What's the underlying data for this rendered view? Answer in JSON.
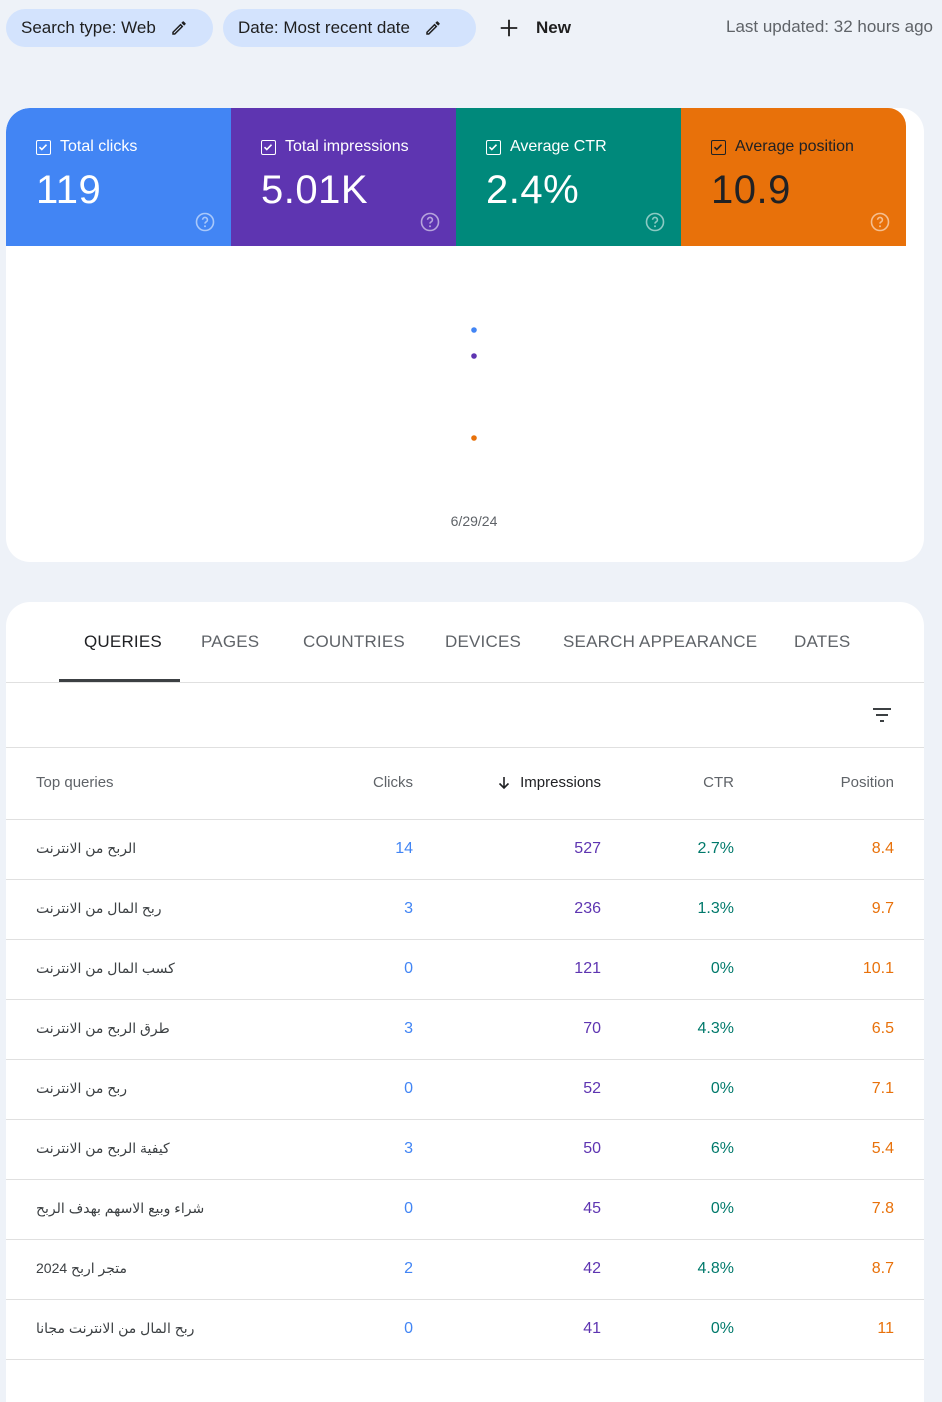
{
  "topbar": {
    "chips": [
      {
        "label": "Search type: Web",
        "icon": "pencil-icon"
      },
      {
        "label": "Date: Most recent date",
        "icon": "pencil-icon"
      }
    ],
    "new_label": "New",
    "last_updated": "Last updated: 32 hours ago"
  },
  "metrics": [
    {
      "label": "Total clicks",
      "value": "119",
      "checked": true,
      "color": "#4285f4"
    },
    {
      "label": "Total impressions",
      "value": "5.01K",
      "checked": true,
      "color": "#5e35b1"
    },
    {
      "label": "Average CTR",
      "value": "2.4%",
      "checked": true,
      "color": "#00897b"
    },
    {
      "label": "Average position",
      "value": "10.9",
      "checked": true,
      "color": "#e8710a"
    }
  ],
  "chart_data": {
    "type": "scatter",
    "title": "",
    "xlabel": "",
    "ylabel": "",
    "x": [
      "6/29/24"
    ],
    "grid": false,
    "series": [
      {
        "name": "Total clicks",
        "values": [
          119
        ],
        "color": "#4285f4"
      },
      {
        "name": "Total impressions",
        "values": [
          5010
        ],
        "color": "#5e35b1"
      },
      {
        "name": "Average CTR",
        "values": [
          2.4
        ],
        "color": "#00897b"
      },
      {
        "name": "Average position",
        "values": [
          10.9
        ],
        "color": "#e8710a"
      }
    ]
  },
  "tabs": [
    {
      "label": "QUERIES",
      "active": true
    },
    {
      "label": "PAGES",
      "active": false
    },
    {
      "label": "COUNTRIES",
      "active": false
    },
    {
      "label": "DEVICES",
      "active": false
    },
    {
      "label": "SEARCH APPEARANCE",
      "active": false
    },
    {
      "label": "DATES",
      "active": false
    }
  ],
  "table": {
    "headers": {
      "query": "Top queries",
      "clicks": "Clicks",
      "impressions": "Impressions",
      "ctr": "CTR",
      "position": "Position"
    },
    "sorted_by": "impressions",
    "rows": [
      {
        "query": "الربح من الانترنت",
        "clicks": "14",
        "impressions": "527",
        "ctr": "2.7%",
        "position": "8.4"
      },
      {
        "query": "ربح المال من الانترنت",
        "clicks": "3",
        "impressions": "236",
        "ctr": "1.3%",
        "position": "9.7"
      },
      {
        "query": "كسب المال من الانترنت",
        "clicks": "0",
        "impressions": "121",
        "ctr": "0%",
        "position": "10.1"
      },
      {
        "query": "طرق الربح من الانترنت",
        "clicks": "3",
        "impressions": "70",
        "ctr": "4.3%",
        "position": "6.5"
      },
      {
        "query": "ربح من الانترنت",
        "clicks": "0",
        "impressions": "52",
        "ctr": "0%",
        "position": "7.1"
      },
      {
        "query": "كيفية الربح من الانترنت",
        "clicks": "3",
        "impressions": "50",
        "ctr": "6%",
        "position": "5.4"
      },
      {
        "query": "شراء وبيع الاسهم بهدف الربح",
        "clicks": "0",
        "impressions": "45",
        "ctr": "0%",
        "position": "7.8"
      },
      {
        "query": "متجر اربح 2024",
        "clicks": "2",
        "impressions": "42",
        "ctr": "4.8%",
        "position": "8.7"
      },
      {
        "query": "ربح المال من الانترنت مجانا",
        "clicks": "0",
        "impressions": "41",
        "ctr": "0%",
        "position": "11"
      }
    ]
  }
}
